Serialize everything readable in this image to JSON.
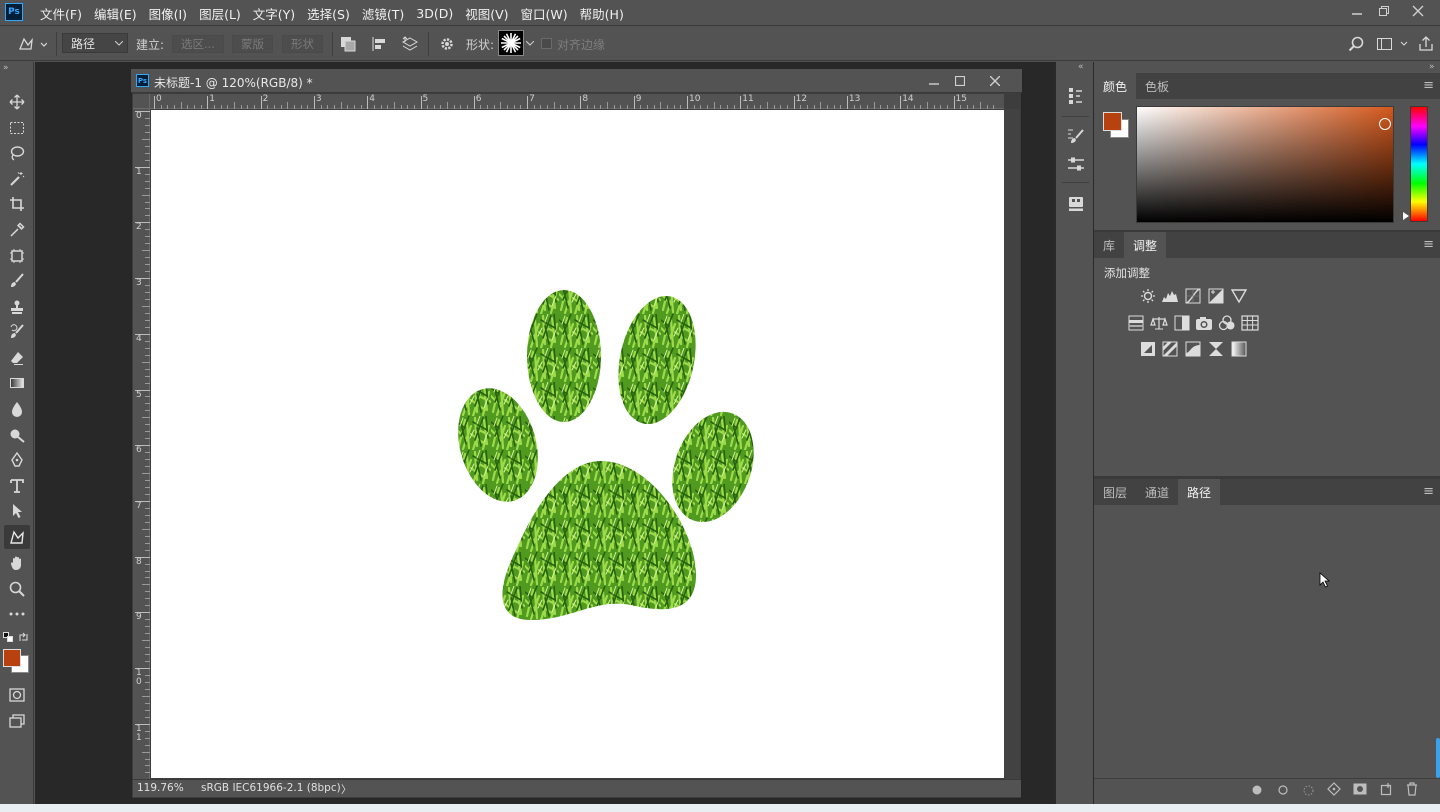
{
  "app": {
    "logo": "Ps"
  },
  "menu": [
    {
      "label": "文件(F)"
    },
    {
      "label": "编辑(E)"
    },
    {
      "label": "图像(I)"
    },
    {
      "label": "图层(L)"
    },
    {
      "label": "文字(Y)"
    },
    {
      "label": "选择(S)"
    },
    {
      "label": "滤镜(T)"
    },
    {
      "label": "3D(D)"
    },
    {
      "label": "视图(V)"
    },
    {
      "label": "窗口(W)"
    },
    {
      "label": "帮助(H)"
    }
  ],
  "options": {
    "mode_value": "路径",
    "make_label": "建立:",
    "selection_btn": "选区...",
    "mask_btn": "蒙版",
    "shape_btn": "形状",
    "shape_label": "形状:",
    "align_edges_label": "对齐边缘"
  },
  "document": {
    "title": "未标题-1 @ 120%(RGB/8) *",
    "zoom": "119.76%",
    "profile": "sRGB IEC61966-2.1 (8bpc)",
    "status_arrow": "〉",
    "hruler_labels": [
      "0",
      "1",
      "2",
      "3",
      "4",
      "5",
      "6",
      "7",
      "8",
      "9",
      "10",
      "11",
      "12",
      "13",
      "14",
      "15"
    ],
    "vruler_labels": [
      "0",
      "1",
      "2",
      "3",
      "4",
      "5",
      "6",
      "7",
      "8",
      "9",
      "1\n0",
      "1\n1"
    ]
  },
  "color_panel": {
    "tabs": [
      {
        "label": "颜色"
      },
      {
        "label": "色板"
      }
    ],
    "foreground": "#b8420f",
    "background": "#ffffff",
    "hue_base": "#d4581c"
  },
  "adjust_panel": {
    "tabs": [
      {
        "label": "库"
      },
      {
        "label": "调整"
      }
    ],
    "add_label": "添加调整"
  },
  "paths_panel": {
    "tabs": [
      {
        "label": "图层"
      },
      {
        "label": "通道"
      },
      {
        "label": "路径"
      }
    ]
  },
  "colors": {
    "accent_fg": "#b8420f",
    "grass_dark": "#2f6e14",
    "grass_light": "#8fd43c"
  }
}
